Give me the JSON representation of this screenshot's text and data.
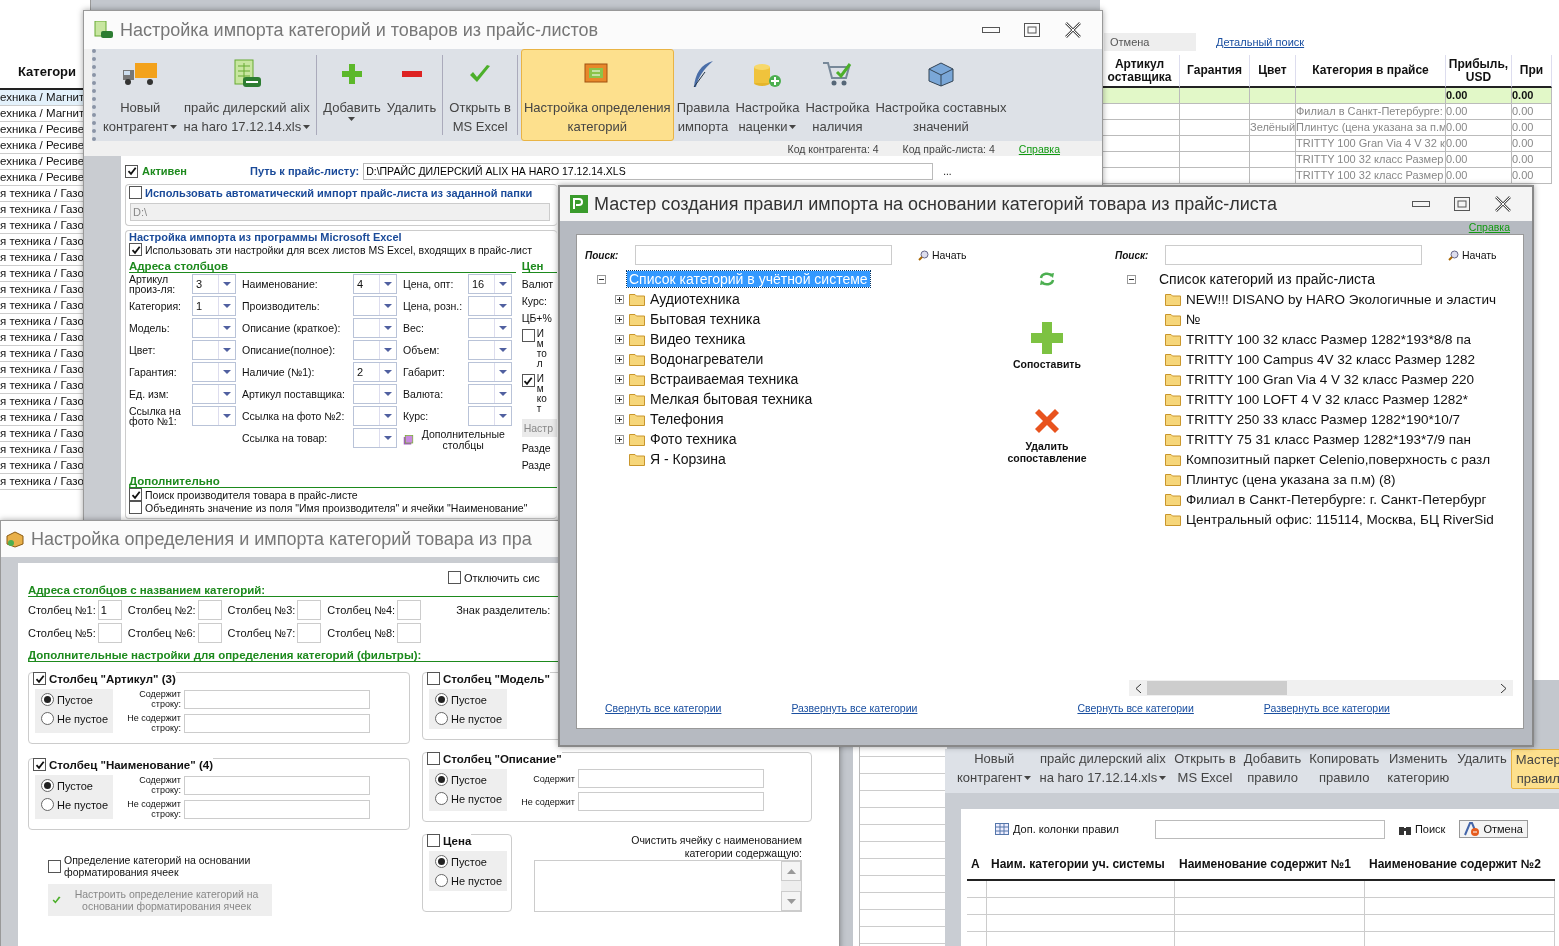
{
  "background": {
    "category_list": {
      "header": "Категори",
      "rows": [
        "ехника / Магнит",
        "ехника / Магнит",
        "ехника / Ресиве",
        "ехника / Ресиве",
        "ехника / Ресиве",
        "ехника / Ресиве",
        "я техника / Газо",
        "я техника / Газо",
        "я техника / Газо",
        "я техника / Газо",
        "я техника / Газо",
        "я техника / Газо",
        "я техника / Газо",
        "я техника / Газо",
        "я техника / Газо",
        "я техника / Газо",
        "я техника / Газо",
        "я техника / Газо",
        "я техника / Газо",
        "я техника / Газо",
        "я техника / Газо",
        "я техника / Газо",
        "я техника / Газо",
        "я техника / Газо",
        "я техника / Газо"
      ]
    },
    "cancel_button": "Отмена",
    "detailed_search_link": "Детальный поиск",
    "grid": {
      "columns": [
        "Артикул оставщика",
        "Гарантия",
        "Цвет",
        "Категория в прайсе",
        "Прибыль, USD",
        "При"
      ],
      "total_row": {
        "profit": "0.00",
        "column_6": "0.00"
      },
      "rows": [
        {
          "category": "Филиал в Санкт-Петербурге:",
          "profit": "0.00",
          "column_6": "0.00"
        },
        {
          "colour_name": "Зелёный",
          "category": "Плинтус (цена указана за п.м",
          "profit": "0.00",
          "column_6": "0.00"
        },
        {
          "category": "TRITTY 100 Gran Via 4 V   32 к",
          "profit": "0.00",
          "column_6": "0.00"
        },
        {
          "category": "TRITTY 100  32 класс  Размер",
          "profit": "0.00",
          "column_6": "0.00"
        },
        {
          "category": "TRITTY 100  32 класс  Размер",
          "profit": "0.00",
          "column_6": "0.00"
        }
      ]
    },
    "rules_window": {
      "toolbar": [
        {
          "lines": [
            "Новый",
            "контрагент"
          ],
          "dropdown": true,
          "selected": false
        },
        {
          "lines": [
            "прайс дилерский alix",
            "на haro 17.12.14.xls"
          ],
          "dropdown": true,
          "selected": false
        },
        {
          "lines": [
            "Открыть в",
            "MS Excel"
          ],
          "dropdown": false,
          "selected": false
        },
        {
          "lines": [
            "Добавить",
            "правило"
          ],
          "dropdown": false,
          "selected": false
        },
        {
          "lines": [
            "Копировать",
            "правило"
          ],
          "dropdown": false,
          "selected": false
        },
        {
          "lines": [
            "Изменить",
            "категорию"
          ],
          "dropdown": false,
          "selected": false
        },
        {
          "lines": [
            "Удалить"
          ],
          "dropdown": false,
          "selected": false
        },
        {
          "lines": [
            "Мастер",
            "правил"
          ],
          "dropdown": false,
          "selected": true
        }
      ],
      "columns_button": "Доп. колонки правил",
      "search_button": "Поиск",
      "cancel_button": "Отмена",
      "table_columns": [
        "А",
        "Наим. категории уч. системы",
        "Наименование содержит №1",
        "Наименование содержит №2"
      ]
    }
  },
  "import_window": {
    "title": "Настройка импорта категорий и товаров из прайс-листов",
    "toolbar": [
      {
        "lines": [
          "Новый",
          "контрагент"
        ],
        "dropdown": true,
        "selected": false
      },
      {
        "lines": [
          "прайс дилерский alix",
          "на haro 17.12.14.xls"
        ],
        "dropdown": true,
        "selected": false
      },
      {
        "lines": [
          "Добавить"
        ],
        "dropdown": true,
        "selected": false
      },
      {
        "lines": [
          "Удалить"
        ],
        "dropdown": false,
        "selected": false
      },
      {
        "lines": [
          "Открыть в",
          "MS Excel"
        ],
        "dropdown": false,
        "selected": false
      },
      {
        "lines": [
          "Настройка определения",
          "категорий"
        ],
        "dropdown": false,
        "selected": true
      },
      {
        "lines": [
          "Правила",
          "импорта"
        ],
        "dropdown": false,
        "selected": false
      },
      {
        "lines": [
          "Настройка",
          "наценки"
        ],
        "dropdown": true,
        "selected": false
      },
      {
        "lines": [
          "Настройка",
          "наличия"
        ],
        "dropdown": false,
        "selected": false
      },
      {
        "lines": [
          "Настройка составных",
          "значений"
        ],
        "dropdown": false,
        "selected": false
      }
    ],
    "contractor_code": "Код контрагента: 4",
    "pricelist_code": "Код прайс-листа: 4",
    "help_link": "Справка",
    "active": {
      "label": "Активен",
      "checked": true
    },
    "path_label": "Путь к прайс-листу:",
    "path_value": "D:\\ПРАЙС ДИЛЕРСКИЙ ALIX НА HARO 17.12.14.XLS",
    "browse_button": "...",
    "auto_import": {
      "label": "Использовать автоматический импорт прайс-листа из заданной папки",
      "checked": false,
      "folder": "D:\\"
    },
    "excel_heading": "Настройка импорта из программы Microsoft Excel",
    "all_sheets": {
      "label": "Использовать эти настройки для всех листов MS Excel, входящих в прайс-лист",
      "checked": true
    },
    "addresses_heading": "Адреса столбцов",
    "address_columns": [
      [
        {
          "label": "Артикул произ-ля:",
          "value": "3"
        },
        {
          "label": "Категория:",
          "value": "1"
        },
        {
          "label": "Модель:"
        },
        {
          "label": "Цвет:"
        },
        {
          "label": "Гарантия:"
        },
        {
          "label": "Ед. изм:"
        },
        {
          "label": "Ссылка на фото №1:"
        }
      ],
      [
        {
          "label": "Наименование:",
          "value": "4"
        },
        {
          "label": "Производитель:"
        },
        {
          "label": "Описание (краткое):"
        },
        {
          "label": "Описание(полное):"
        },
        {
          "label": "Наличие (№1):",
          "value": "2"
        },
        {
          "label": "Артикул поставщика:"
        },
        {
          "label": "Ссылка на фото №2:"
        },
        {
          "label": "Ссылка на товар:"
        }
      ],
      [
        {
          "label": "Цена, опт:",
          "value": "16"
        },
        {
          "label": "Цена, розн.:"
        },
        {
          "label": "Вес:"
        },
        {
          "label": "Объем:"
        },
        {
          "label": "Габарит:"
        },
        {
          "label": "Валюта:"
        },
        {
          "label": "Курс:"
        }
      ]
    ],
    "extra_columns_button": "Дополнительные столбцы",
    "price_heading": "Цен",
    "price_items": [
      {
        "kind": "text",
        "label": "Валют"
      },
      {
        "kind": "text",
        "label": "Курс:"
      },
      {
        "kind": "text",
        "label": "ЦБ+%"
      },
      {
        "kind": "checkbox",
        "label": "Им тол",
        "checked": false
      },
      {
        "kind": "checkbox",
        "label": "Им кот",
        "checked": true
      },
      {
        "kind": "button",
        "label": "Настр"
      },
      {
        "kind": "text",
        "label": "Разде"
      },
      {
        "kind": "text",
        "label": "Разде"
      }
    ],
    "extra_heading": "Дополнительно",
    "extra_options": [
      {
        "label": "Поиск производителя товара в прайс-листе",
        "checked": true
      },
      {
        "label": "Объединять значение из поля \"Имя производителя\" и ячейки \"Наименование\"",
        "checked": false
      }
    ]
  },
  "category_window": {
    "title": "Настройка определения и импорта категорий товара из пра",
    "disable_option": {
      "label": "Отключить сис",
      "checked": false
    },
    "addresses_heading": "Адреса столбцов с названием категорий:",
    "columns": [
      {
        "label": "Столбец №1:",
        "value": "1"
      },
      {
        "label": "Столбец №2:"
      },
      {
        "label": "Столбец №3:"
      },
      {
        "label": "Столбец №4:"
      },
      {
        "label": "Столбец №5:"
      },
      {
        "label": "Столбец №6:"
      },
      {
        "label": "Столбец №7:"
      },
      {
        "label": "Столбец №8:"
      }
    ],
    "separator_label": "Знак разделитель:",
    "filters_heading": "Дополнительные настройки для определения категорий (фильтры):",
    "left_filters": [
      {
        "title": "Столбец \"Артикул\" (3)",
        "checked": true,
        "options": [
          {
            "label": "Пустое",
            "selected": true
          },
          {
            "label": "Не пустое",
            "selected": false
          }
        ],
        "fields": [
          "Содержит строку:",
          "Не содержит строку:"
        ]
      },
      {
        "title": "Столбец \"Наименование\" (4)",
        "checked": true,
        "options": [
          {
            "label": "Пустое",
            "selected": true
          },
          {
            "label": "Не пустое",
            "selected": false
          }
        ],
        "fields": [
          "Содержит строку:",
          "Не содержит строку:"
        ]
      }
    ],
    "right_filters": [
      {
        "title": "Столбец \"Модель\"",
        "checked": false,
        "options": [
          {
            "label": "Пустое",
            "selected": true
          },
          {
            "label": "Не пустое",
            "selected": false
          }
        ]
      },
      {
        "title": "Столбец \"Описание\"",
        "checked": false,
        "options": [
          {
            "label": "Пустое",
            "selected": true
          },
          {
            "label": "Не пустое",
            "selected": false
          }
        ],
        "fields": [
          "Содержит",
          "Не содержит"
        ]
      }
    ],
    "price_filter": {
      "title": "Цена",
      "checked": false,
      "options": [
        {
          "label": "Пустое",
          "selected": true
        },
        {
          "label": "Не пустое",
          "selected": false
        }
      ]
    },
    "format_option": {
      "label": "Определение категорий на основании форматирования ячеек",
      "checked": false
    },
    "format_button": "Настроить определение категорий на основании форматирования ячеек",
    "clear_label": "Очистить ячейку с наименованием категории содержащую:"
  },
  "wizard": {
    "title": "Мастер создания правил импорта на основании категорий товара из прайс-листа",
    "help_link": "Справка",
    "left_tree": {
      "search_label": "Поиск:",
      "start_button": "Начать",
      "root": {
        "label": "Список категорий в учётной системе",
        "selected": true,
        "expanded": true,
        "children": [
          {
            "label": "Аудиотехника",
            "expandable": true
          },
          {
            "label": "Бытовая техника",
            "expandable": true
          },
          {
            "label": "Видео техника",
            "expandable": true
          },
          {
            "label": "Водонагреватели",
            "expandable": true
          },
          {
            "label": "Встраиваемая техника",
            "expandable": true
          },
          {
            "label": "Мелкая бытовая техника",
            "expandable": true
          },
          {
            "label": "Телефония",
            "expandable": true
          },
          {
            "label": "Фото техника",
            "expandable": true
          },
          {
            "label": "Я - Корзина",
            "expandable": false
          }
        ]
      },
      "collapse_link": "Свернуть все категории",
      "expand_link": "Развернуть все категории"
    },
    "match_button": "Сопоставить",
    "unmatch_button": "Удалить сопоставление",
    "right_tree": {
      "search_label": "Поиск:",
      "start_button": "Начать",
      "root": {
        "label": "Список категорий из прайс-листа",
        "selected": false,
        "expanded": true,
        "children": [
          {
            "label": "NEW!!! DISANO by HARO  Экологичные и эластич",
            "expandable": false
          },
          {
            "label": "№",
            "expandable": false
          },
          {
            "label": "TRITTY 100  32 класс  Размер 1282*193*8/8 па",
            "expandable": false
          },
          {
            "label": "TRITTY 100 Campus 4V   32 класс  Размер 1282",
            "expandable": false
          },
          {
            "label": "TRITTY 100 Gran Via 4 V   32 класс  Размер 220",
            "expandable": false
          },
          {
            "label": "TRITTY 100 LOFT 4 V    32 класс  Размер 1282*",
            "expandable": false
          },
          {
            "label": "TRITTY 250   33 класс  Размер 1282*190*10/7",
            "expandable": false
          },
          {
            "label": "TRITTY 75   31 класс  Размер 1282*193*7/9 пан",
            "expandable": false
          },
          {
            "label": "Композитный паркет Celenio,поверхность с разл",
            "expandable": false
          },
          {
            "label": "Плинтус (цена указана за п.м) (8)",
            "expandable": false
          },
          {
            "label": "Филиал в Санкт-Петербурге: г. Санкт-Петербург",
            "expandable": false
          },
          {
            "label": "Центральный офис: 115114, Москва, БЦ RiverSid",
            "expandable": false
          }
        ]
      },
      "collapse_link": "Свернуть все категории",
      "expand_link": "Развернуть все категории"
    }
  }
}
